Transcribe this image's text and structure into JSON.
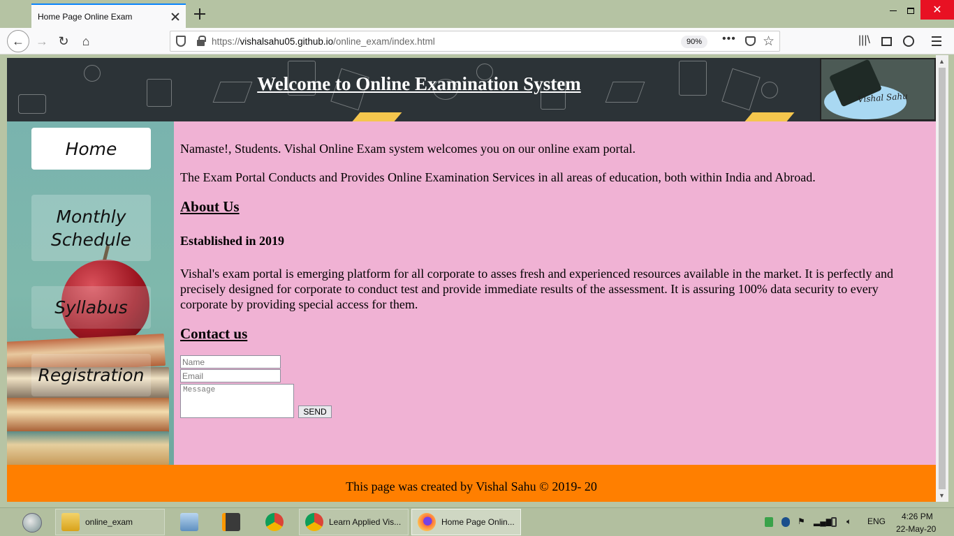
{
  "browser": {
    "tab_title": "Home Page Online Exam",
    "url_host": "vishalsahu05.github.io",
    "url_prefix": "https://",
    "url_path": "/online_exam/index.html",
    "zoom": "90%",
    "more_glyph": "•••"
  },
  "page": {
    "banner_title": "Welcome to Online Examination System",
    "logo_text": "Vishal Sahu",
    "nav": {
      "home": "Home",
      "monthly": "Monthly Schedule",
      "syllabus": "Syllabus",
      "registration": "Registration"
    },
    "intro_1": "Namaste!, Students. Vishal Online Exam system welcomes you on our online exam portal.",
    "intro_2": "The Exam Portal Conducts and Provides Online Examination Services in all areas of education, both within India and Abroad.",
    "about_heading": "About Us",
    "established": "Established in 2019",
    "about_text": "Vishal's exam portal is emerging platform for all corporate to asses fresh and experienced resources available in the market. It is perfectly and precisely designed for corporate to conduct test and provide immediate results of the assessment. It is assuring 100% data security to every corporate by providing special access for them.",
    "contact_heading": "Contact us",
    "form": {
      "name_placeholder": "Name",
      "email_placeholder": "Email",
      "message_placeholder": "Message",
      "send_label": "SEND"
    },
    "footer": "This page was created by Vishal Sahu © 2019- 20"
  },
  "taskbar": {
    "items": [
      {
        "label": "online_exam",
        "icon": "folder-icon"
      },
      {
        "label": "",
        "icon": "calculator-icon"
      },
      {
        "label": "",
        "icon": "sublime-text-icon"
      },
      {
        "label": "",
        "icon": "chrome-icon"
      },
      {
        "label": "Learn Applied Vis...",
        "icon": "chrome-icon"
      },
      {
        "label": "Home Page Onlin...",
        "icon": "firefox-icon"
      }
    ],
    "language": "ENG",
    "time": "4:26 PM",
    "date": "22-May-20"
  },
  "colors": {
    "page_background": "#f0b2d4",
    "footer_background": "#ff7f00",
    "banner_background": "#2c3337",
    "sidebar_background": "#79b3ae",
    "tab_accent": "#0a84ff"
  }
}
